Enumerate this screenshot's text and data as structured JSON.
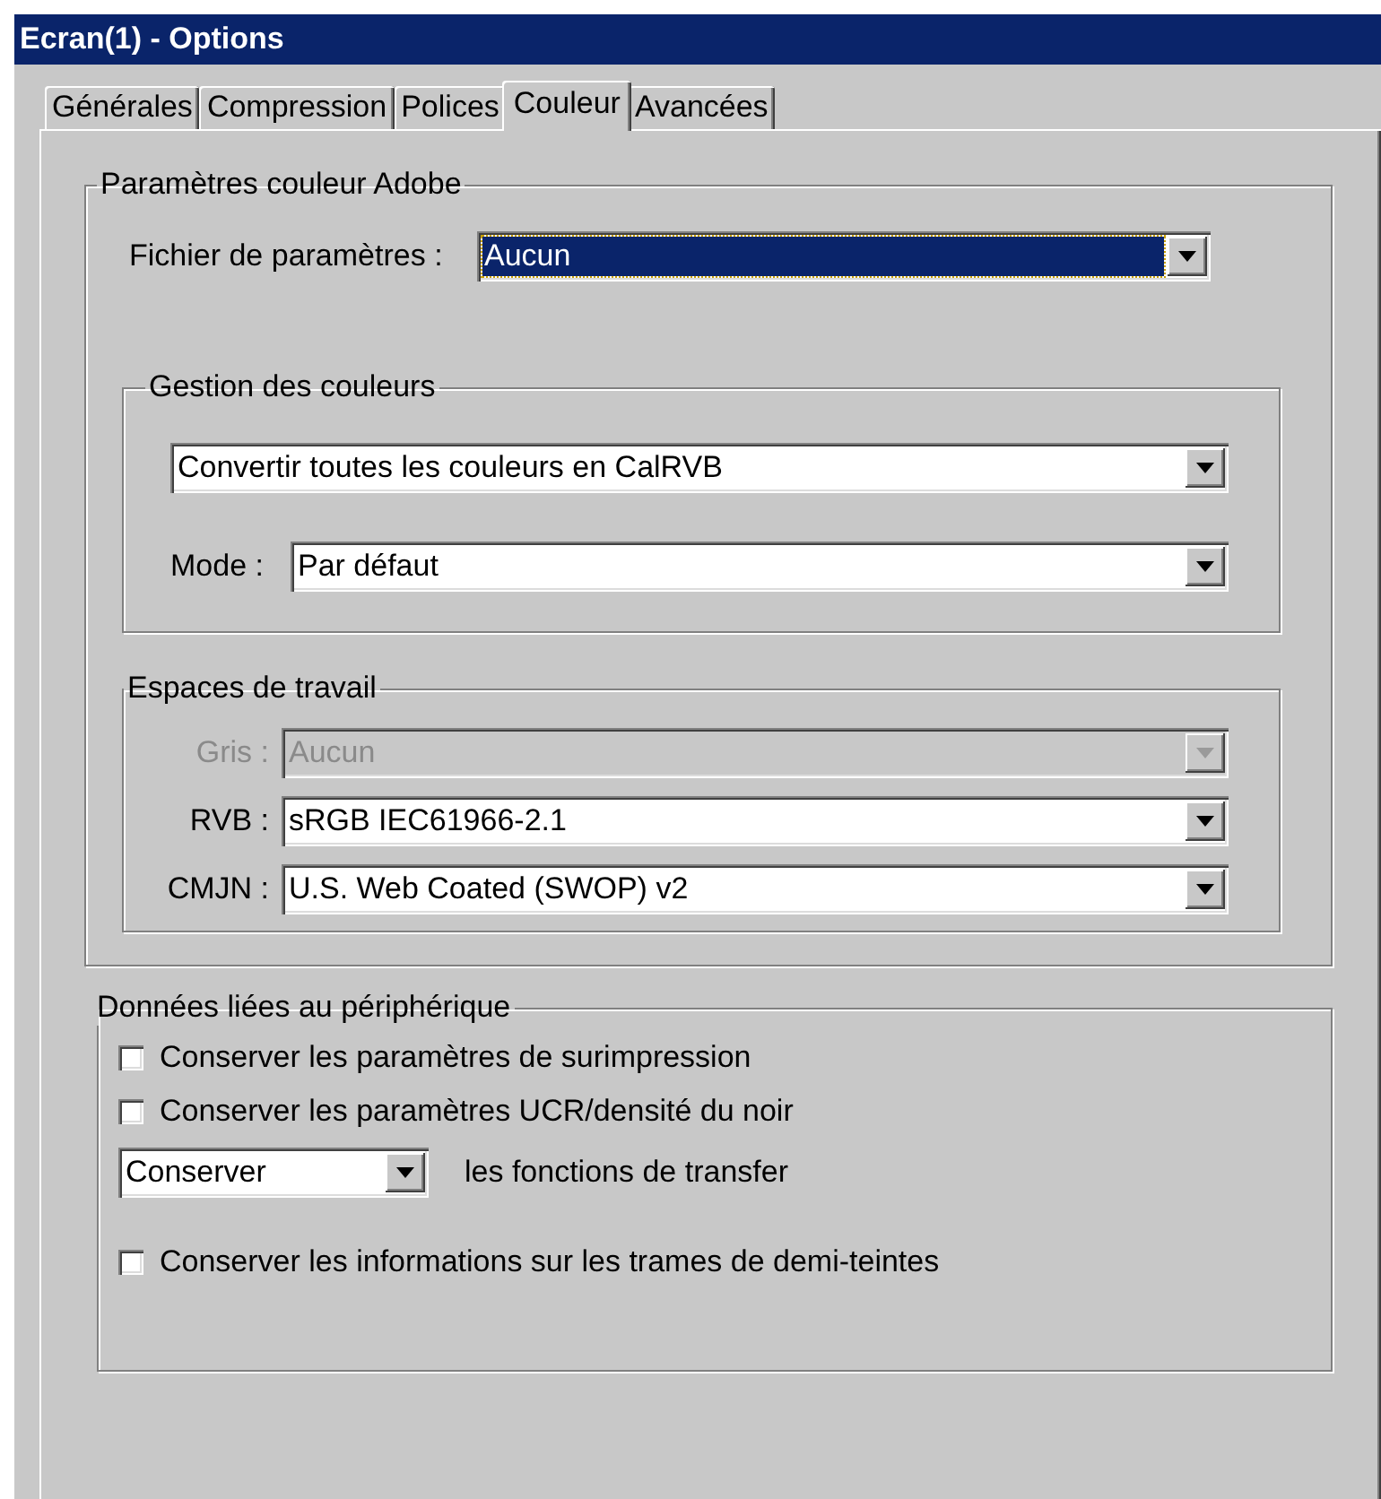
{
  "window": {
    "title": "Ecran(1) - Options"
  },
  "tabs": [
    {
      "label": "Générales",
      "selected": false
    },
    {
      "label": "Compression",
      "selected": false
    },
    {
      "label": "Polices",
      "selected": false
    },
    {
      "label": "Couleur",
      "selected": true
    },
    {
      "label": "Avancées",
      "selected": false
    }
  ],
  "adobe_settings": {
    "title": "Paramètres couleur Adobe",
    "settings_file": {
      "label": "Fichier de paramètres :",
      "value": "Aucun",
      "selected": true
    },
    "color_management": {
      "title": "Gestion des couleurs",
      "policy": {
        "value": "Convertir toutes les couleurs en CalRVB"
      },
      "mode": {
        "label": "Mode :",
        "value": "Par défaut"
      }
    },
    "working_spaces": {
      "title": "Espaces de travail",
      "items": [
        {
          "label": "Gris :",
          "value": "Aucun",
          "disabled": true
        },
        {
          "label": "RVB :",
          "value": "sRGB IEC61966-2.1",
          "disabled": false
        },
        {
          "label": "CMJN :",
          "value": "U.S. Web Coated (SWOP) v2",
          "disabled": false
        }
      ]
    }
  },
  "device_data": {
    "title": "Données liées au périphérique",
    "options": [
      {
        "kind": "checkbox",
        "label": "Conserver les paramètres de surimpression",
        "checked": false
      },
      {
        "kind": "checkbox",
        "label": "Conserver les paramètres UCR/densité du noir",
        "checked": false
      },
      {
        "kind": "combo",
        "value": "Conserver",
        "suffix": "les fonctions de transfer"
      },
      {
        "kind": "checkbox",
        "label": "Conserver les informations sur les trames de demi-teintes",
        "checked": false
      }
    ]
  }
}
